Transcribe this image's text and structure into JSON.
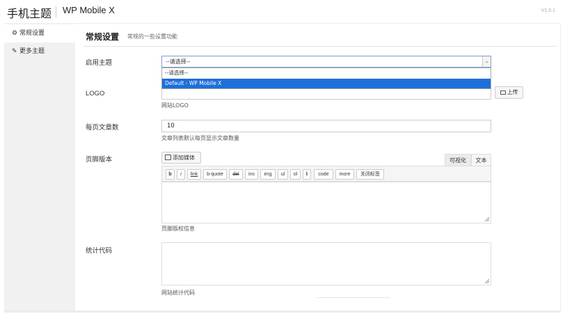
{
  "header": {
    "title": "手机主题",
    "subtitle": "WP Mobile X",
    "version": "V1.0.1"
  },
  "sidebar": {
    "items": [
      {
        "label": "常规设置",
        "icon": "gear-icon",
        "active": true
      },
      {
        "label": "更多主题",
        "icon": "wrench-icon",
        "active": false
      }
    ]
  },
  "main": {
    "title": "常规设置",
    "description": "常规的一些设置功能"
  },
  "form": {
    "theme": {
      "label": "启用主题",
      "value": "--请选择--",
      "options": [
        "--请选择--",
        "Default - WP Mobile X"
      ],
      "highlighted": "Default - WP Mobile X"
    },
    "logo": {
      "label": "LOGO",
      "value": "",
      "upload_label": "上传",
      "help": "网站LOGO"
    },
    "posts_per_page": {
      "label": "每页文章数",
      "value": "10",
      "help": "文章列表默认每页显示文章数量"
    },
    "footer": {
      "label": "页脚版本",
      "add_media": "添加媒体",
      "tab_visual": "可视化",
      "tab_text": "文本",
      "quicktags": [
        "b",
        "i",
        "link",
        "b-quote",
        "del",
        "ins",
        "img",
        "ul",
        "ol",
        "li",
        "code",
        "more",
        "关闭标签"
      ],
      "value": "",
      "help": "页脚版权信息"
    },
    "stats": {
      "label": "统计代码",
      "value": "",
      "help": "网站统计代码"
    }
  },
  "colors": {
    "accent": "#1e6fd9",
    "sidebar_bg": "#f1f1f1",
    "border": "#cccccc"
  }
}
